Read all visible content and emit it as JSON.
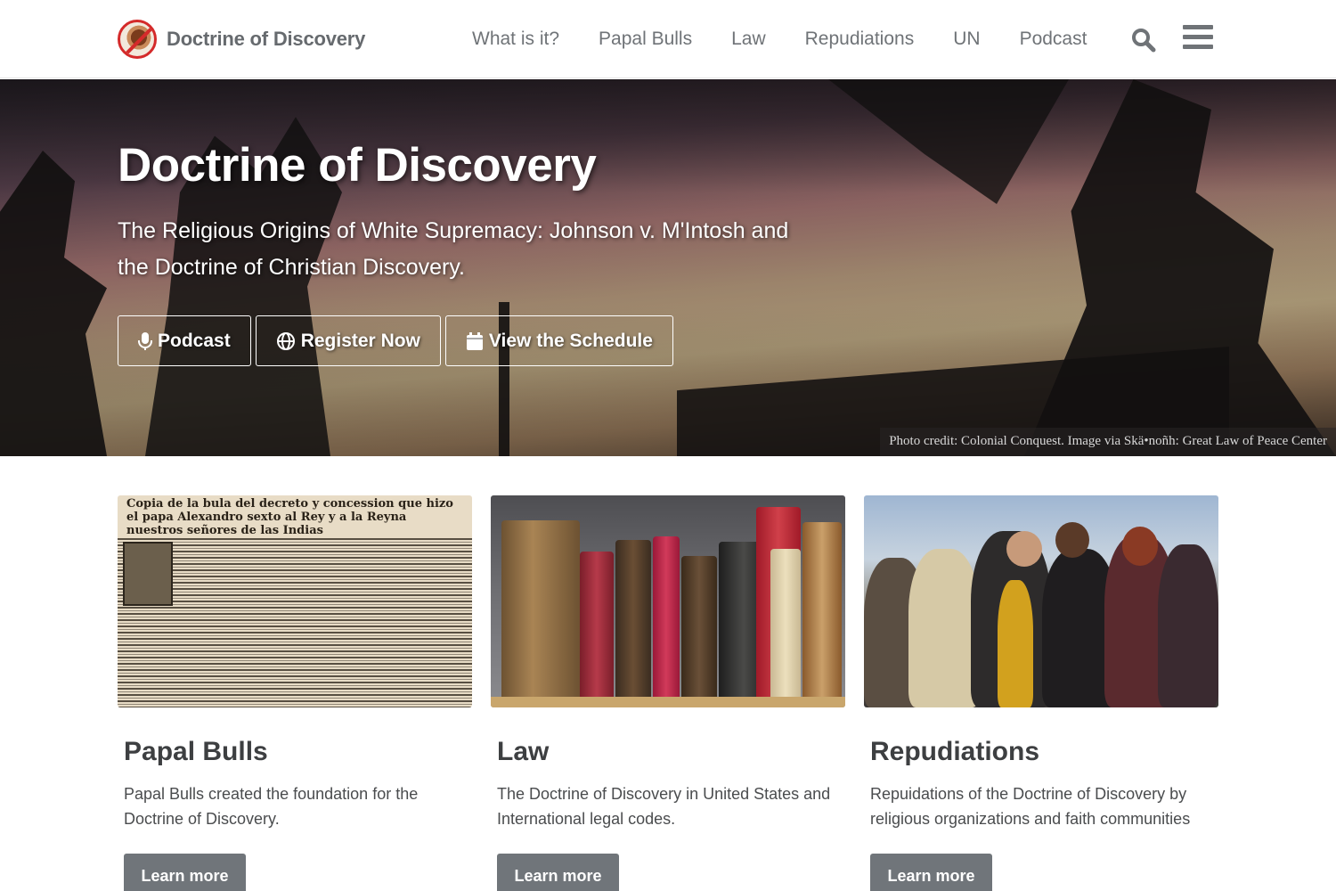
{
  "brand": {
    "name": "Doctrine of Discovery"
  },
  "nav": {
    "links": [
      "What is it?",
      "Papal Bulls",
      "Law",
      "Repudiations",
      "UN",
      "Podcast"
    ],
    "search_icon": "search-icon",
    "menu_icon": "hamburger-menu-icon"
  },
  "hero": {
    "title": "Doctrine of Discovery",
    "subtitle": "The Religious Origins of White Supremacy: Johnson v. M'Intosh and the Doctrine of Christian Discovery.",
    "buttons": [
      {
        "label": "Podcast",
        "icon": "microphone-icon"
      },
      {
        "label": "Register Now",
        "icon": "globe-icon"
      },
      {
        "label": "View the Schedule",
        "icon": "calendar-icon"
      }
    ],
    "photo_credit": "Photo credit: Colonial Conquest. Image via Skä•noñh: Great Law of Peace Center"
  },
  "cards": [
    {
      "title": "Papal Bulls",
      "text": "Papal Bulls created the foundation for the Doctrine of Discovery.",
      "button": "Learn more",
      "image_text": "Copia de la bula del decreto y concession que hizo el papa Alexandro sexto al Rey y a la Reyna nuestros señores de las Indias"
    },
    {
      "title": "Law",
      "text": "The Doctrine of Discovery in United States and International legal codes.",
      "button": "Learn more"
    },
    {
      "title": "Repudiations",
      "text": "Repuidations of the Doctrine of Discovery by religious organizations and faith communities",
      "button": "Learn more"
    }
  ],
  "colors": {
    "nav_text": "#6f7377",
    "button_gray": "#70757a",
    "title_dark": "#3d3f41",
    "logo_red": "#d42a2a"
  }
}
